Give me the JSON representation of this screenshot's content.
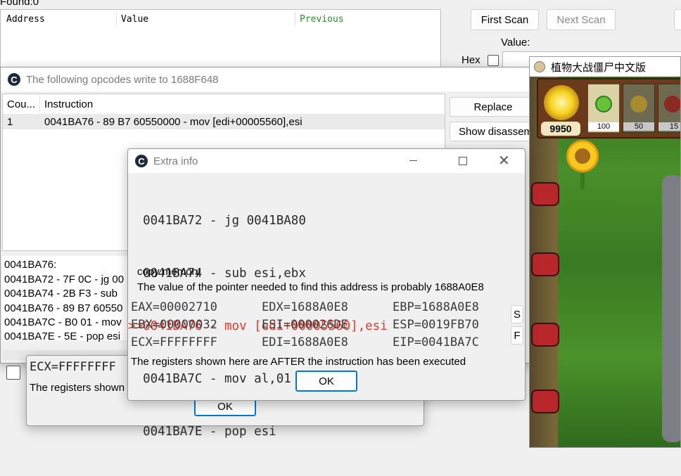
{
  "main": {
    "found_label": "Found:0",
    "columns": {
      "address": "Address",
      "value": "Value",
      "previous": "Previous"
    },
    "first_scan": "First Scan",
    "next_scan": "Next Scan",
    "value_label": "Value:",
    "hex_label": "Hex",
    "previous_color": "#2e8b2e"
  },
  "opcodes_window": {
    "title": "The following opcodes write to 1688F648",
    "headers": {
      "count": "Cou...",
      "instruction": "Instruction"
    },
    "rows": [
      {
        "count": "1",
        "instruction": "0041BA76 - 89 B7 60550000  - mov [edi+00005560],esi"
      }
    ],
    "replace_button": "Replace",
    "show_disasm_button": "Show disassem",
    "disasm_lines": [
      "0041BA76:",
      "0041BA72 - 7F 0C - jg 00",
      "0041BA74 - 2B F3  - sub",
      "0041BA76 - 89 B7 60550",
      "0041BA7C - B0 01 - mov",
      "0041BA7E - 5E - pop esi"
    ]
  },
  "back_dialog": {
    "ecx_partial": "ECX=FFFFFFFF",
    "registers_note": "The registers shown",
    "ok": "OK"
  },
  "extra_info": {
    "title": "Extra info",
    "code_lines": [
      {
        "text": "  0041BA72 - jg 0041BA80",
        "highlight": false
      },
      {
        "text": "  0041BA74 - sub esi,ebx",
        "highlight": false
      },
      {
        "text": ">>0041BA76 - mov [edi+00005560],esi",
        "highlight": true
      },
      {
        "text": "  0041BA7C - mov al,01",
        "highlight": false
      },
      {
        "text": "  0041BA7E - pop esi",
        "highlight": false
      }
    ],
    "copy_memory": "copy memory",
    "pointer_note": "The value of the pointer needed to find this address is probably 1688A0E8",
    "registers": [
      [
        "EAX=00002710",
        "EDX=1688A0E8",
        "EBP=1688A0E8"
      ],
      [
        "EBX=00000032",
        "ESI=000026DE",
        "ESP=0019FB70"
      ],
      [
        "ECX=FFFFFFFF",
        "EDI=1688A0E8",
        "EIP=0041BA7C"
      ]
    ],
    "side_s": "S",
    "side_f": "F",
    "footer_note": "The registers shown here are AFTER the instruction has been executed",
    "ok": "OK",
    "highlight_color": "#e23b2e"
  },
  "game": {
    "title": "植物大战僵尸中文版",
    "sun_count": "9950",
    "seed_costs": [
      "100",
      "50",
      "15"
    ]
  }
}
